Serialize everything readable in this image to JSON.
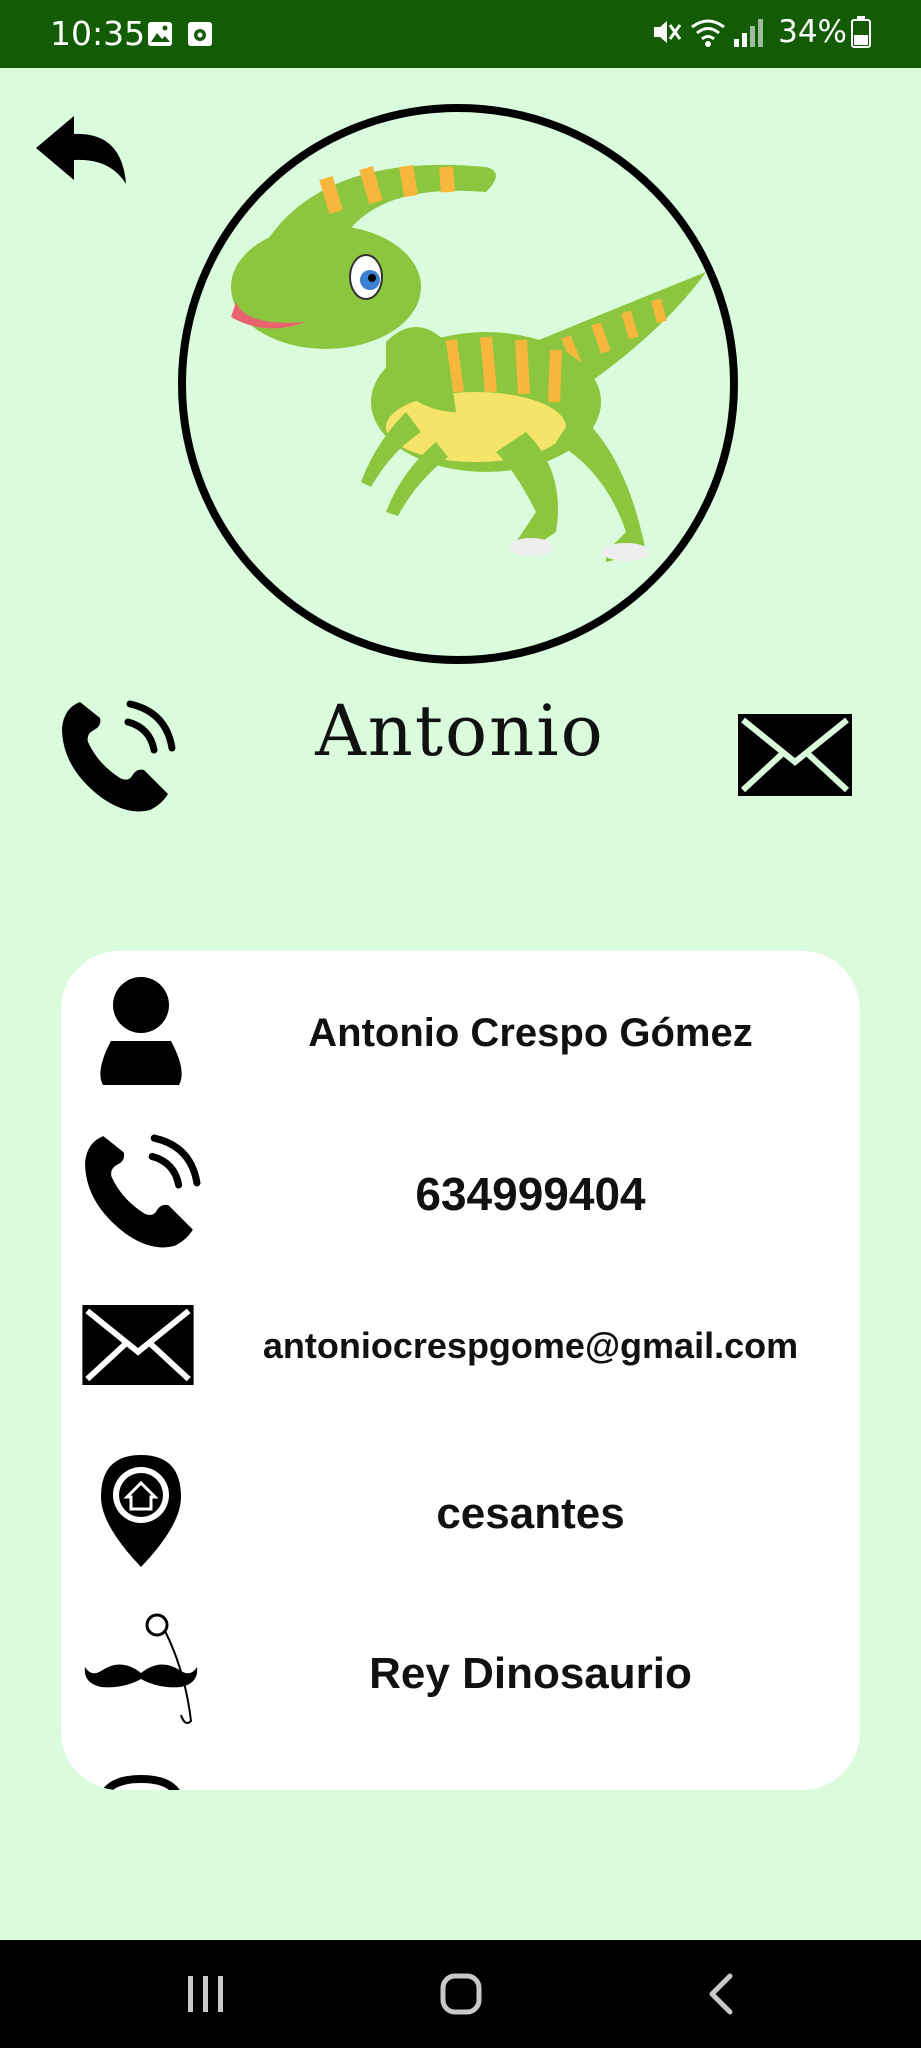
{
  "status_bar": {
    "time": "10:35",
    "battery": "34%",
    "icons": [
      "image-icon",
      "record-icon",
      "mute-icon",
      "wifi-icon",
      "signal-icon",
      "battery-icon"
    ]
  },
  "header": {
    "back_icon": "back-arrow-icon",
    "avatar": "dinosaur-avatar",
    "name": "Antonio",
    "call_icon": "phone-icon",
    "mail_icon": "envelope-icon"
  },
  "details": {
    "full_name": "Antonio Crespo Gómez",
    "phone": "634999404",
    "email": "antoniocrespgome@gmail.com",
    "address": "cesantes",
    "nickname": "Rey Dinosaurio"
  },
  "nav": {
    "items": [
      "recents-icon",
      "home-icon",
      "back-icon"
    ]
  },
  "colors": {
    "background": "#dafcdc",
    "status_bar": "#135b05",
    "card": "#ffffff",
    "nav_bar": "#000000"
  }
}
